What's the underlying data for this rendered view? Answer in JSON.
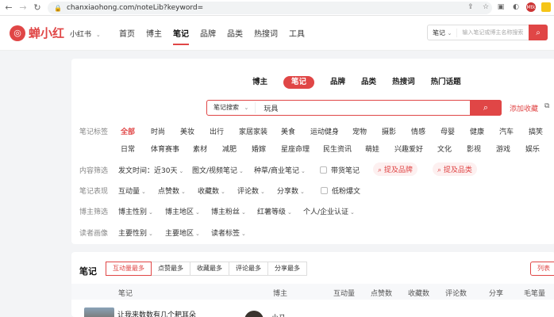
{
  "browser": {
    "url": "chanxiaohong.com/noteLib?keyword=",
    "ext_badge": "Mtk"
  },
  "header": {
    "logo_text": "蝉小红",
    "platform": "小红书",
    "nav": [
      "首页",
      "博主",
      "笔记",
      "品牌",
      "品类",
      "热搜词",
      "工具"
    ],
    "search_select": "笔记",
    "search_placeholder": "输入笔记或博主名称搜索"
  },
  "filter": {
    "categories": [
      "博主",
      "笔记",
      "品牌",
      "品类",
      "热搜词",
      "热门话题"
    ],
    "active_category": "笔记",
    "search_select": "笔记搜索",
    "search_value": "玩具",
    "add_favorite": "添加收藏",
    "tags_label": "笔记标签",
    "tags_row1": [
      "全部",
      "时尚",
      "美妆",
      "出行",
      "家居家装",
      "美食",
      "运动健身",
      "宠物",
      "摄影",
      "情感",
      "母婴",
      "健康",
      "汽车",
      "搞笑"
    ],
    "tags_row2": [
      "日常",
      "体育赛事",
      "素材",
      "减肥",
      "婚嫁",
      "星座命理",
      "民生资讯",
      "萌娃",
      "兴趣爱好",
      "文化",
      "影视",
      "游戏",
      "娱乐"
    ],
    "content_label": "内容筛选",
    "content": {
      "publish_time": "发文时间：近30天",
      "media_type": "图文/视频笔记",
      "seed_type": "种草/商业笔记",
      "brand_note": "带货笔记",
      "brand_pill": "提及品牌",
      "category_pill": "提及品类"
    },
    "perf_label": "笔记表现",
    "perf": [
      "互动量",
      "点赞数",
      "收藏数",
      "评论数",
      "分享数"
    ],
    "low_fan": "低粉爆文",
    "blogger_label": "博主筛选",
    "blogger": [
      "博主性别",
      "博主地区",
      "博主粉丝",
      "红薯等级",
      "个人/企业认证"
    ],
    "reader_label": "读者画像",
    "reader": [
      "主要性别",
      "主要地区",
      "读者标签"
    ]
  },
  "notes": {
    "title": "笔记",
    "sort_tabs": [
      "互动量最多",
      "点赞最多",
      "收藏最多",
      "评论最多",
      "分享最多"
    ],
    "list_button": "列表",
    "columns": [
      "笔记",
      "博主",
      "互动量",
      "点赞数",
      "收藏数",
      "评论数",
      "分享",
      "毛笔量"
    ],
    "rows": [
      {
        "title": "让我来数数有几个耙耳朵",
        "blogger": "小马"
      }
    ]
  },
  "colors": {
    "accent": "#e04646"
  }
}
